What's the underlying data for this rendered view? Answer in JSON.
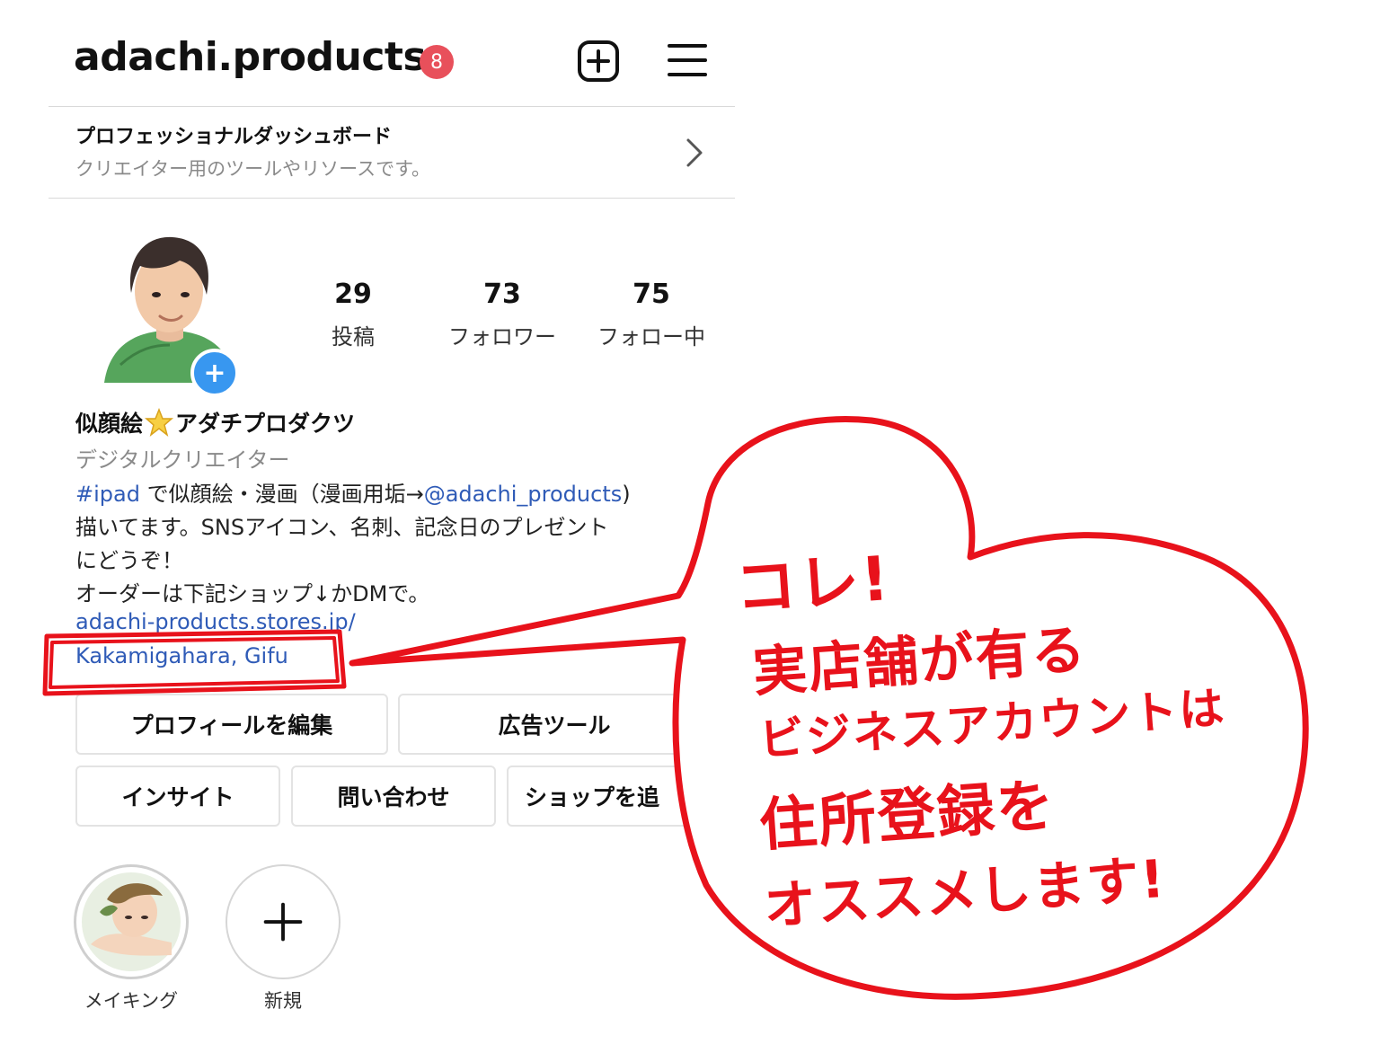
{
  "header": {
    "username": "adachi.products",
    "notification_count": "8",
    "new_post_icon": "plus-square-icon",
    "menu_icon": "hamburger-menu-icon"
  },
  "dashboard": {
    "title": "プロフェッショナルダッシュボード",
    "subtitle": "クリエイター用のツールやリソースです。"
  },
  "stats": {
    "posts_count": "29",
    "posts_label": "投稿",
    "followers_count": "73",
    "followers_label": "フォロワー",
    "following_count": "75",
    "following_label": "フォロー中"
  },
  "profile": {
    "name_part1": "似顔絵",
    "name_part2": "アダチプロダクツ",
    "category": "デジタルクリエイター",
    "bio_hashtag": "#ipad",
    "bio_line1_text": " で似顔絵・漫画（漫画用垢→",
    "bio_mention": "@adachi_products",
    "bio_line1_end": ")",
    "bio_line2": "描いてます。SNSアイコン、名刺、記念日のプレゼント",
    "bio_line3": "にどうぞ！",
    "bio_line4": "オーダーは下記ショップ↓かDMで。",
    "website": "adachi-products.stores.jp/",
    "location": "Kakamigahara, Gifu"
  },
  "buttons": {
    "edit_profile": "プロフィールを編集",
    "ad_tools": "広告ツール",
    "insights": "インサイト",
    "contact": "問い合わせ",
    "add_shop": "ショップを追"
  },
  "highlights": [
    {
      "label": "メイキング"
    },
    {
      "label": "新規"
    }
  ],
  "annotation": {
    "line1": "コレ!",
    "line2": "実店舗が有る",
    "line3": "ビジネスアカウントは",
    "line4": "住所登録を",
    "line5": "オススメします!",
    "color": "#e8121b"
  }
}
